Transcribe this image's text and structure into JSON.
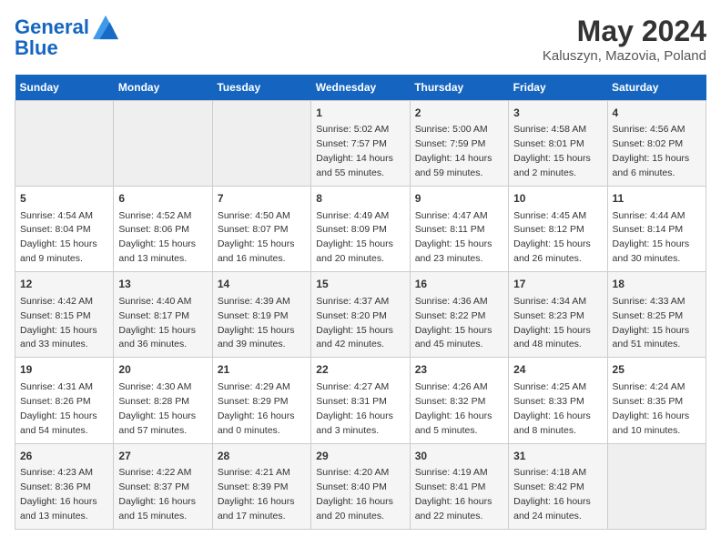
{
  "header": {
    "logo_line1": "General",
    "logo_line2": "Blue",
    "main_title": "May 2024",
    "subtitle": "Kaluszyn, Mazovia, Poland"
  },
  "days_of_week": [
    "Sunday",
    "Monday",
    "Tuesday",
    "Wednesday",
    "Thursday",
    "Friday",
    "Saturday"
  ],
  "weeks": [
    [
      {
        "day": "",
        "info": ""
      },
      {
        "day": "",
        "info": ""
      },
      {
        "day": "",
        "info": ""
      },
      {
        "day": "1",
        "info": "Sunrise: 5:02 AM\nSunset: 7:57 PM\nDaylight: 14 hours\nand 55 minutes."
      },
      {
        "day": "2",
        "info": "Sunrise: 5:00 AM\nSunset: 7:59 PM\nDaylight: 14 hours\nand 59 minutes."
      },
      {
        "day": "3",
        "info": "Sunrise: 4:58 AM\nSunset: 8:01 PM\nDaylight: 15 hours\nand 2 minutes."
      },
      {
        "day": "4",
        "info": "Sunrise: 4:56 AM\nSunset: 8:02 PM\nDaylight: 15 hours\nand 6 minutes."
      }
    ],
    [
      {
        "day": "5",
        "info": "Sunrise: 4:54 AM\nSunset: 8:04 PM\nDaylight: 15 hours\nand 9 minutes."
      },
      {
        "day": "6",
        "info": "Sunrise: 4:52 AM\nSunset: 8:06 PM\nDaylight: 15 hours\nand 13 minutes."
      },
      {
        "day": "7",
        "info": "Sunrise: 4:50 AM\nSunset: 8:07 PM\nDaylight: 15 hours\nand 16 minutes."
      },
      {
        "day": "8",
        "info": "Sunrise: 4:49 AM\nSunset: 8:09 PM\nDaylight: 15 hours\nand 20 minutes."
      },
      {
        "day": "9",
        "info": "Sunrise: 4:47 AM\nSunset: 8:11 PM\nDaylight: 15 hours\nand 23 minutes."
      },
      {
        "day": "10",
        "info": "Sunrise: 4:45 AM\nSunset: 8:12 PM\nDaylight: 15 hours\nand 26 minutes."
      },
      {
        "day": "11",
        "info": "Sunrise: 4:44 AM\nSunset: 8:14 PM\nDaylight: 15 hours\nand 30 minutes."
      }
    ],
    [
      {
        "day": "12",
        "info": "Sunrise: 4:42 AM\nSunset: 8:15 PM\nDaylight: 15 hours\nand 33 minutes."
      },
      {
        "day": "13",
        "info": "Sunrise: 4:40 AM\nSunset: 8:17 PM\nDaylight: 15 hours\nand 36 minutes."
      },
      {
        "day": "14",
        "info": "Sunrise: 4:39 AM\nSunset: 8:19 PM\nDaylight: 15 hours\nand 39 minutes."
      },
      {
        "day": "15",
        "info": "Sunrise: 4:37 AM\nSunset: 8:20 PM\nDaylight: 15 hours\nand 42 minutes."
      },
      {
        "day": "16",
        "info": "Sunrise: 4:36 AM\nSunset: 8:22 PM\nDaylight: 15 hours\nand 45 minutes."
      },
      {
        "day": "17",
        "info": "Sunrise: 4:34 AM\nSunset: 8:23 PM\nDaylight: 15 hours\nand 48 minutes."
      },
      {
        "day": "18",
        "info": "Sunrise: 4:33 AM\nSunset: 8:25 PM\nDaylight: 15 hours\nand 51 minutes."
      }
    ],
    [
      {
        "day": "19",
        "info": "Sunrise: 4:31 AM\nSunset: 8:26 PM\nDaylight: 15 hours\nand 54 minutes."
      },
      {
        "day": "20",
        "info": "Sunrise: 4:30 AM\nSunset: 8:28 PM\nDaylight: 15 hours\nand 57 minutes."
      },
      {
        "day": "21",
        "info": "Sunrise: 4:29 AM\nSunset: 8:29 PM\nDaylight: 16 hours\nand 0 minutes."
      },
      {
        "day": "22",
        "info": "Sunrise: 4:27 AM\nSunset: 8:31 PM\nDaylight: 16 hours\nand 3 minutes."
      },
      {
        "day": "23",
        "info": "Sunrise: 4:26 AM\nSunset: 8:32 PM\nDaylight: 16 hours\nand 5 minutes."
      },
      {
        "day": "24",
        "info": "Sunrise: 4:25 AM\nSunset: 8:33 PM\nDaylight: 16 hours\nand 8 minutes."
      },
      {
        "day": "25",
        "info": "Sunrise: 4:24 AM\nSunset: 8:35 PM\nDaylight: 16 hours\nand 10 minutes."
      }
    ],
    [
      {
        "day": "26",
        "info": "Sunrise: 4:23 AM\nSunset: 8:36 PM\nDaylight: 16 hours\nand 13 minutes."
      },
      {
        "day": "27",
        "info": "Sunrise: 4:22 AM\nSunset: 8:37 PM\nDaylight: 16 hours\nand 15 minutes."
      },
      {
        "day": "28",
        "info": "Sunrise: 4:21 AM\nSunset: 8:39 PM\nDaylight: 16 hours\nand 17 minutes."
      },
      {
        "day": "29",
        "info": "Sunrise: 4:20 AM\nSunset: 8:40 PM\nDaylight: 16 hours\nand 20 minutes."
      },
      {
        "day": "30",
        "info": "Sunrise: 4:19 AM\nSunset: 8:41 PM\nDaylight: 16 hours\nand 22 minutes."
      },
      {
        "day": "31",
        "info": "Sunrise: 4:18 AM\nSunset: 8:42 PM\nDaylight: 16 hours\nand 24 minutes."
      },
      {
        "day": "",
        "info": ""
      }
    ]
  ]
}
